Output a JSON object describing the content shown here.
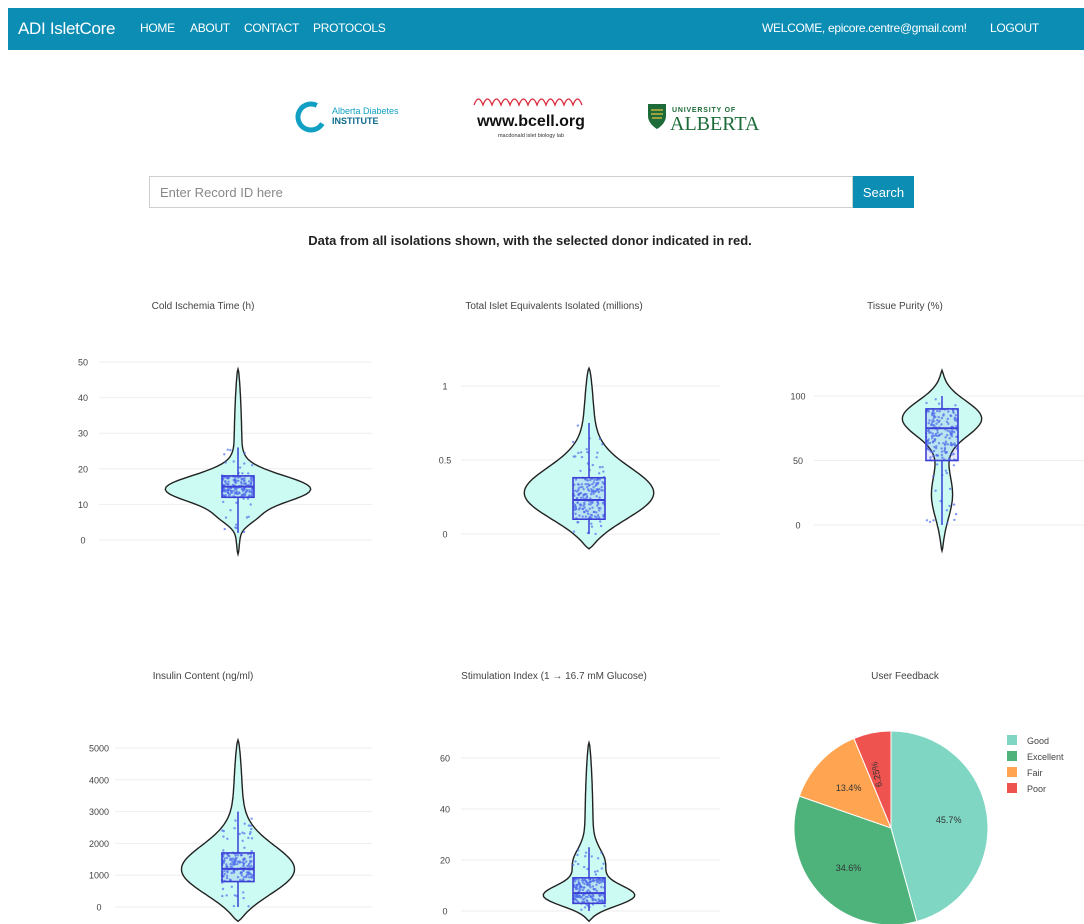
{
  "nav": {
    "brand": "ADI IsletCore",
    "links": [
      "HOME",
      "ABOUT",
      "CONTACT",
      "PROTOCOLS"
    ],
    "welcome": "WELCOME, epicore.centre@gmail.com!",
    "logout": "LOGOUT"
  },
  "logos": {
    "adi": {
      "line1": "Alberta Diabetes",
      "line2": "INSTITUTE"
    },
    "bcell": {
      "main": "www.bcell.org",
      "sub": "macdonald islet biology lab"
    },
    "ualberta": {
      "line1": "UNIVERSITY OF",
      "line2": "ALBERTA"
    }
  },
  "search": {
    "placeholder": "Enter Record ID here",
    "button_label": "Search"
  },
  "subtitle": "Data from all isolations shown, with the selected donor indicated in red.",
  "colors": {
    "navbar": "#0c8db4",
    "violin_fill": "#ccfbf3",
    "box": "#3b3fd6",
    "points": "#4f6ff0",
    "grid": "#eeeeee"
  },
  "chart_data": [
    {
      "type": "violin",
      "title": "Cold Ischemia Time (h)",
      "y_ticks": [
        0,
        10,
        20,
        30,
        40,
        50
      ],
      "ylim": [
        0,
        50
      ],
      "range": [
        -4,
        48
      ],
      "quartiles": [
        12,
        15,
        18
      ],
      "median": 15,
      "whiskers": [
        2,
        26
      ],
      "mode": 14
    },
    {
      "type": "violin",
      "title": "Total Islet Equivalents Isolated (millions)",
      "y_ticks": [
        0,
        0.5,
        1
      ],
      "ylim": [
        0,
        1
      ],
      "range": [
        -0.1,
        1.12
      ],
      "quartiles": [
        0.1,
        0.23,
        0.38
      ],
      "median": 0.23,
      "whiskers": [
        0,
        0.75
      ],
      "mode": 0.22
    },
    {
      "type": "violin",
      "title": "Tissue Purity (%)",
      "y_ticks": [
        0,
        50,
        100
      ],
      "ylim": [
        0,
        100
      ],
      "range": [
        -20,
        120
      ],
      "quartiles": [
        50,
        75,
        90
      ],
      "median": 75,
      "whiskers": [
        0,
        100
      ],
      "mode": 85
    },
    {
      "type": "violin",
      "title": "Insulin Content (ng/ml)",
      "y_ticks": [
        0,
        1000,
        2000,
        3000,
        4000,
        5000
      ],
      "ylim": [
        0,
        5000
      ],
      "range": [
        -450,
        5250
      ],
      "quartiles": [
        800,
        1200,
        1700
      ],
      "median": 1200,
      "whiskers": [
        0,
        3000
      ],
      "mode": 1000
    },
    {
      "type": "violin",
      "title": "Stimulation Index (1 → 16.7 mM Glucose)",
      "y_ticks": [
        0,
        20,
        40,
        60
      ],
      "ylim": [
        0,
        60
      ],
      "range": [
        -4,
        66
      ],
      "quartiles": [
        3,
        7,
        13
      ],
      "median": 7,
      "whiskers": [
        0,
        25
      ],
      "mode": 6
    },
    {
      "type": "pie",
      "title": "User Feedback",
      "labels": [
        "Good",
        "Excellent",
        "Fair",
        "Poor"
      ],
      "values": [
        45.7,
        34.6,
        13.4,
        6.25
      ],
      "display_values": [
        "45.7%",
        "34.6%",
        "13.4%",
        "6.25%"
      ],
      "colors": [
        "#7ed6c3",
        "#4db37a",
        "#ffa552",
        "#ef5350"
      ],
      "legend": "right"
    }
  ]
}
